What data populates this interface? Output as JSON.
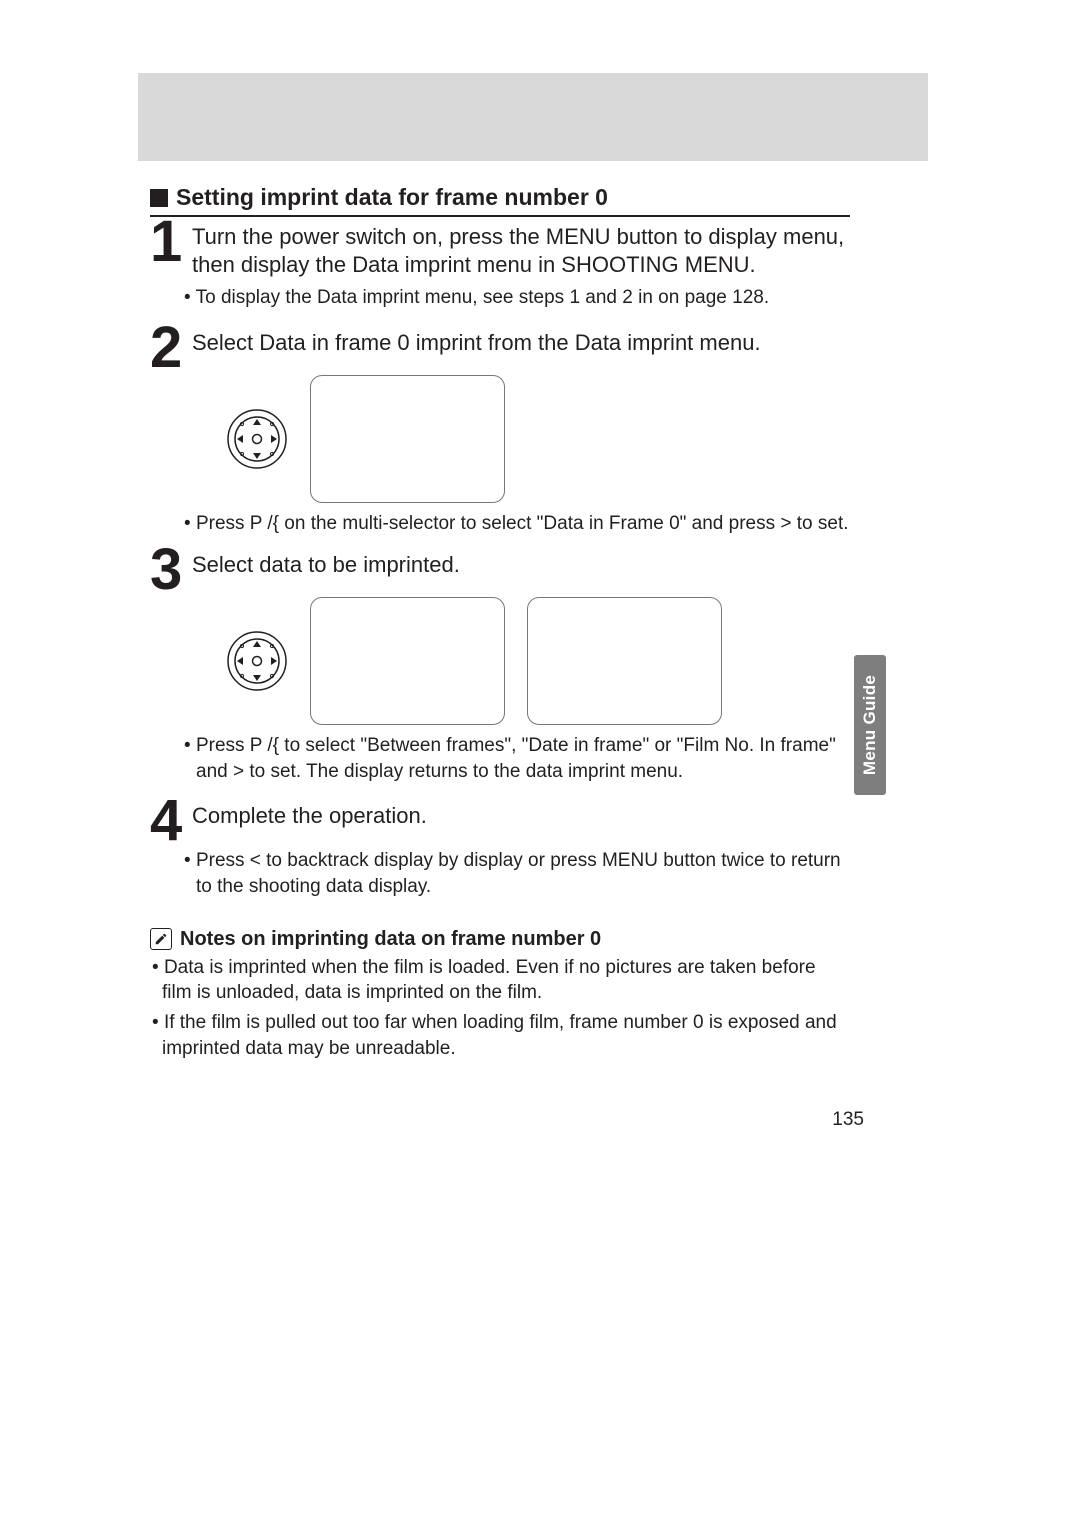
{
  "section_title": "Setting imprint data for frame number 0",
  "side_tab": "Menu Guide",
  "page_number": "135",
  "steps": {
    "s1": {
      "num": "1",
      "head": "Turn the power switch on, press the MENU button to display menu, then display the Data imprint menu in SHOOTING MENU.",
      "sub1": "To display the Data imprint menu, see steps 1 and 2 in on page 128."
    },
    "s2": {
      "num": "2",
      "head": "Select Data in frame 0 imprint from the Data imprint menu.",
      "sub1": "Press P /{  on the multi-selector to select \"Data in Frame 0\" and press > to set."
    },
    "s3": {
      "num": "3",
      "head": "Select data to be imprinted.",
      "sub1": "Press P /{  to select \"Between frames\", \"Date in frame\" or \"Film No. In frame\" and > to set. The display returns to the data imprint menu."
    },
    "s4": {
      "num": "4",
      "head": "Complete the operation.",
      "sub1": "Press < to backtrack display by display or press MENU button twice to return to the shooting data display."
    }
  },
  "notes": {
    "title": "Notes on imprinting data on frame number 0",
    "n1": "Data is imprinted when the film is loaded. Even if no pictures are taken before film is unloaded, data is imprinted on the film.",
    "n2": "If the film is pulled out too far when loading film, frame number 0 is exposed and imprinted data may be unreadable."
  }
}
